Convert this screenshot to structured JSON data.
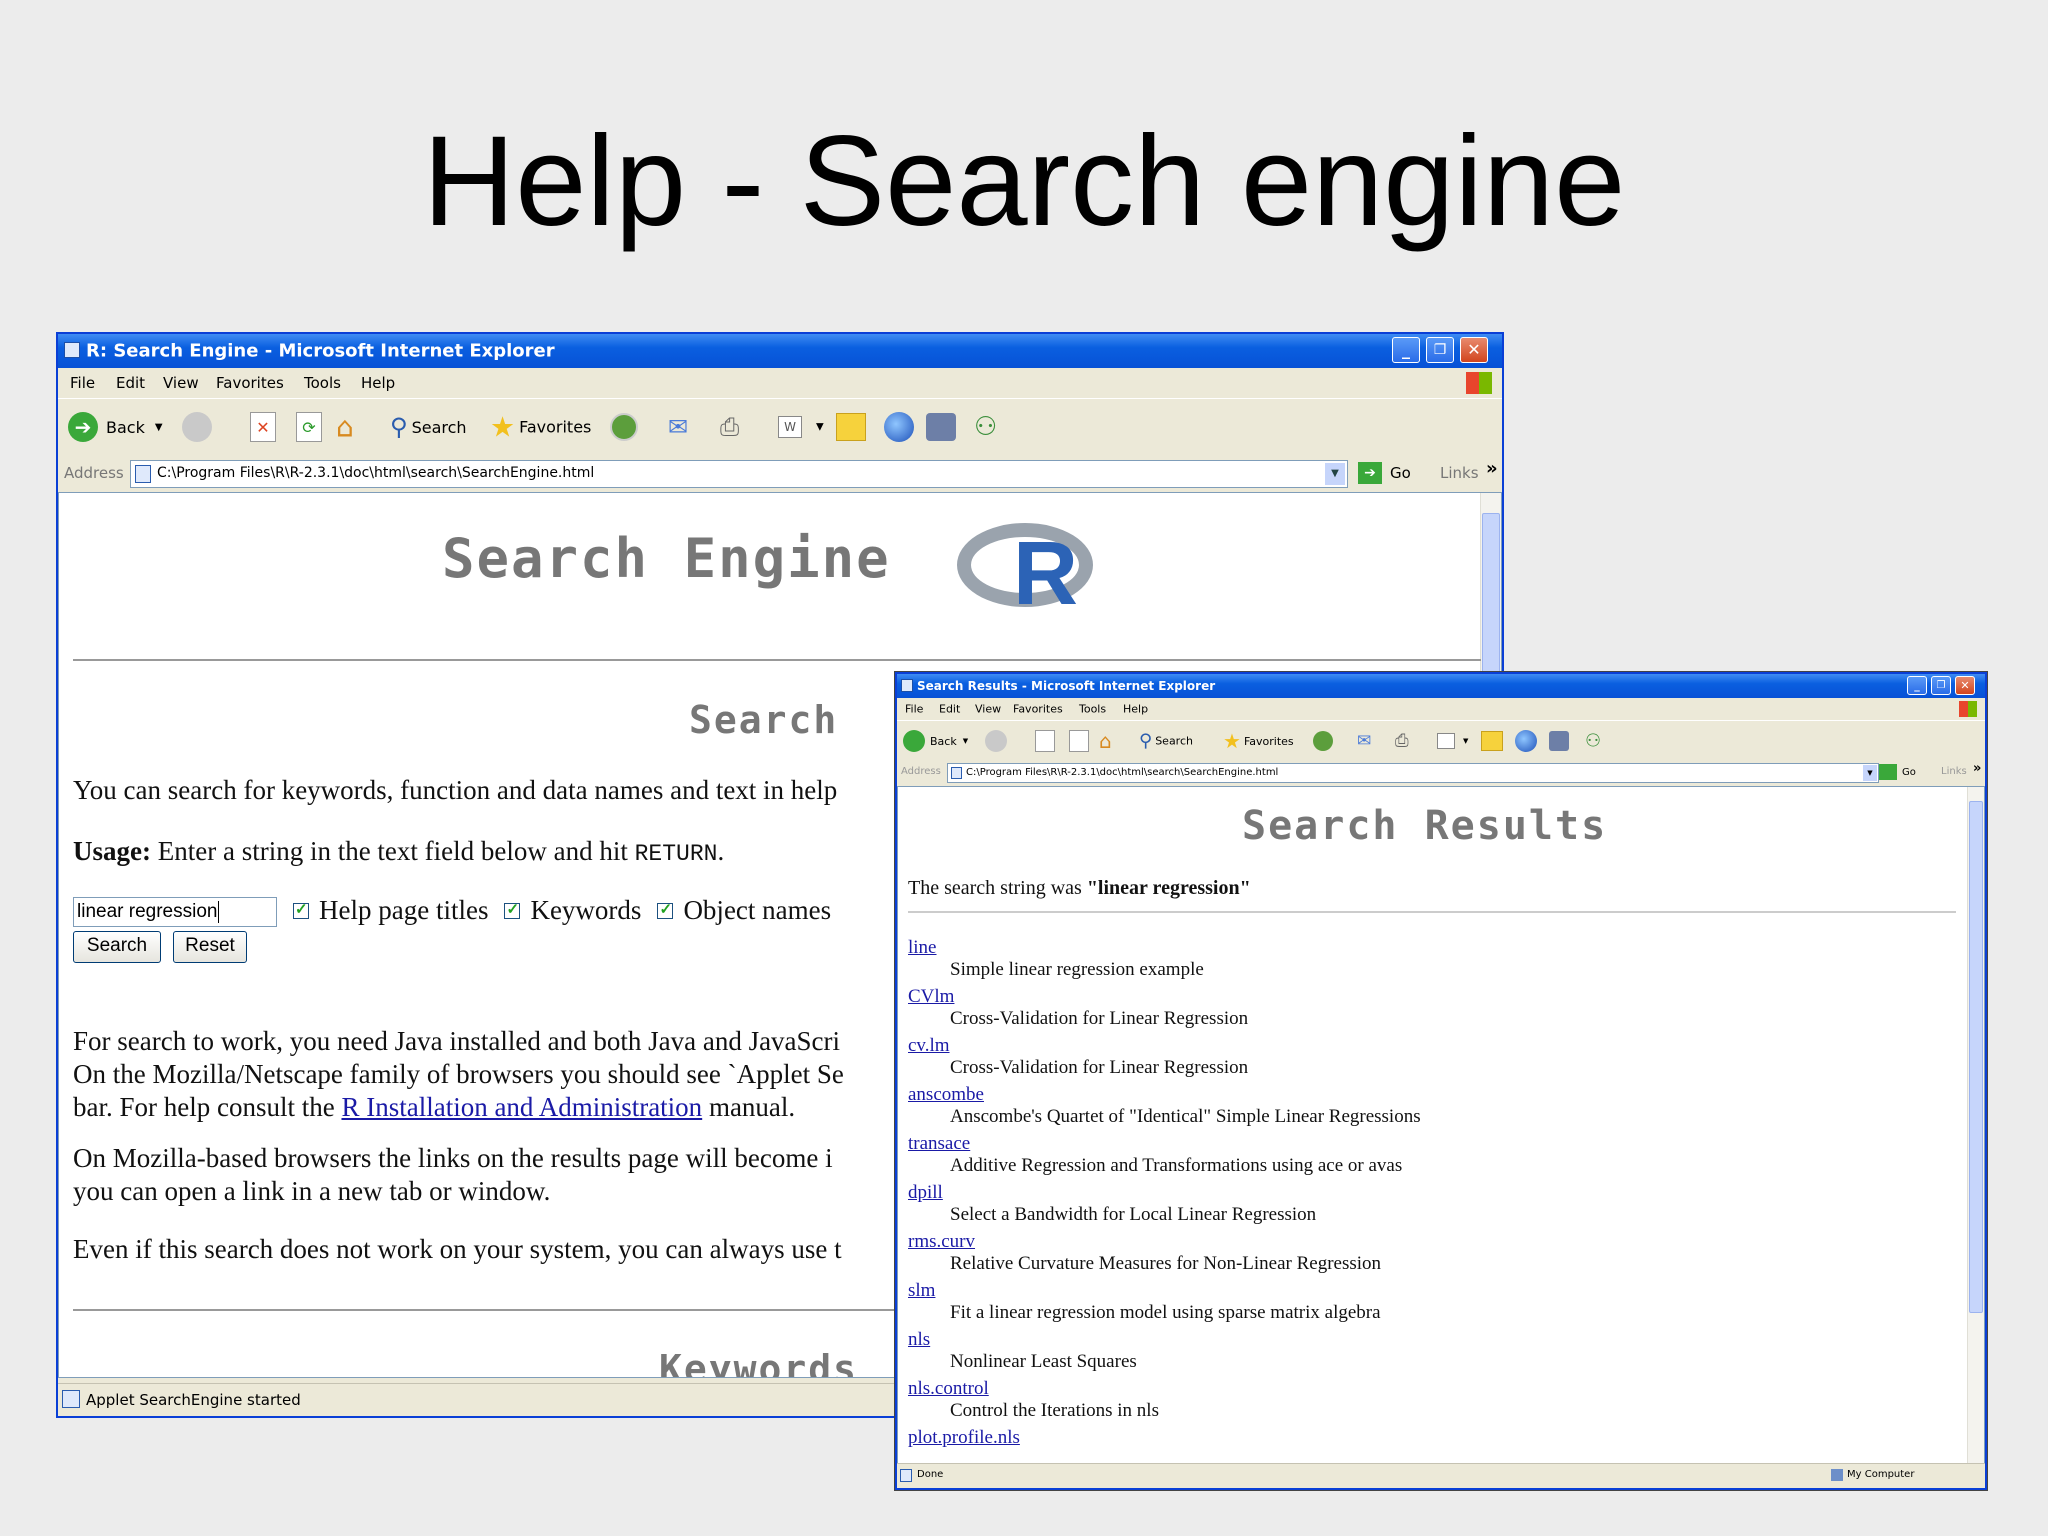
{
  "slide": {
    "title": "Help - Search engine"
  },
  "window1": {
    "title": "R: Search Engine - Microsoft Internet Explorer",
    "menu": [
      "File",
      "Edit",
      "View",
      "Favorites",
      "Tools",
      "Help"
    ],
    "toolbar": {
      "back": "Back",
      "search": "Search",
      "favorites": "Favorites"
    },
    "address_label": "Address",
    "address": "C:\\Program Files\\R\\R-2.3.1\\doc\\html\\search\\SearchEngine.html",
    "go": "Go",
    "links": "Links",
    "page": {
      "heading": "Search Engine",
      "logo_letter": "R",
      "section_search": "Search",
      "intro": "You can search for keywords, function and data names and text in help",
      "usage_label": "Usage:",
      "usage_text": "Enter a string in the text field below and hit",
      "usage_key": "RETURN",
      "usage_end": ".",
      "search_value": "linear regression",
      "checkbox_titles": "Help page titles",
      "checkbox_keywords": "Keywords",
      "checkbox_objects": "Object names",
      "search_button": "Search",
      "reset_button": "Reset",
      "para1_line1": "For search to work, you need Java installed and both Java and JavaScri",
      "para1_line2": "On the Mozilla/Netscape family of browsers you should see `Applet Se",
      "para1_line3_pre": "bar. For help consult the",
      "para1_link": "R Installation and Administration",
      "para1_line3_post": "manual.",
      "para2_line1": "On Mozilla-based browsers the links on the results page will become i",
      "para2_line2": "you can open a link in a new tab or window.",
      "para3": "Even if this search does not work on your system, you can always use t",
      "section_keywords": "Keywords"
    },
    "status": "Applet SearchEngine started"
  },
  "window2": {
    "title": "Search Results - Microsoft Internet Explorer",
    "menu": [
      "File",
      "Edit",
      "View",
      "Favorites",
      "Tools",
      "Help"
    ],
    "toolbar": {
      "back": "Back",
      "search": "Search",
      "favorites": "Favorites"
    },
    "address_label": "Address",
    "address": "C:\\Program Files\\R\\R-2.3.1\\doc\\html\\search\\SearchEngine.html",
    "go": "Go",
    "links": "Links",
    "page": {
      "heading": "Search Results",
      "query_prefix": "The search string was",
      "query": "\"linear regression\"",
      "results": [
        {
          "name": "line",
          "desc": "Simple linear regression example"
        },
        {
          "name": "CVlm",
          "desc": "Cross-Validation for Linear Regression"
        },
        {
          "name": "cv.lm",
          "desc": "Cross-Validation for Linear Regression"
        },
        {
          "name": "anscombe",
          "desc": "Anscombe's Quartet of \"Identical\" Simple Linear Regressions"
        },
        {
          "name": "transace",
          "desc": "Additive Regression and Transformations using ace or avas"
        },
        {
          "name": "dpill",
          "desc": "Select a Bandwidth for Local Linear Regression"
        },
        {
          "name": "rms.curv",
          "desc": "Relative Curvature Measures for Non-Linear Regression"
        },
        {
          "name": "slm",
          "desc": "Fit a linear regression model using sparse matrix algebra"
        },
        {
          "name": "nls",
          "desc": "Nonlinear Least Squares"
        },
        {
          "name": "nls.control",
          "desc": "Control the Iterations in nls"
        },
        {
          "name": "plot.profile.nls",
          "desc": ""
        }
      ]
    },
    "status_left": "Done",
    "status_right": "My Computer"
  }
}
